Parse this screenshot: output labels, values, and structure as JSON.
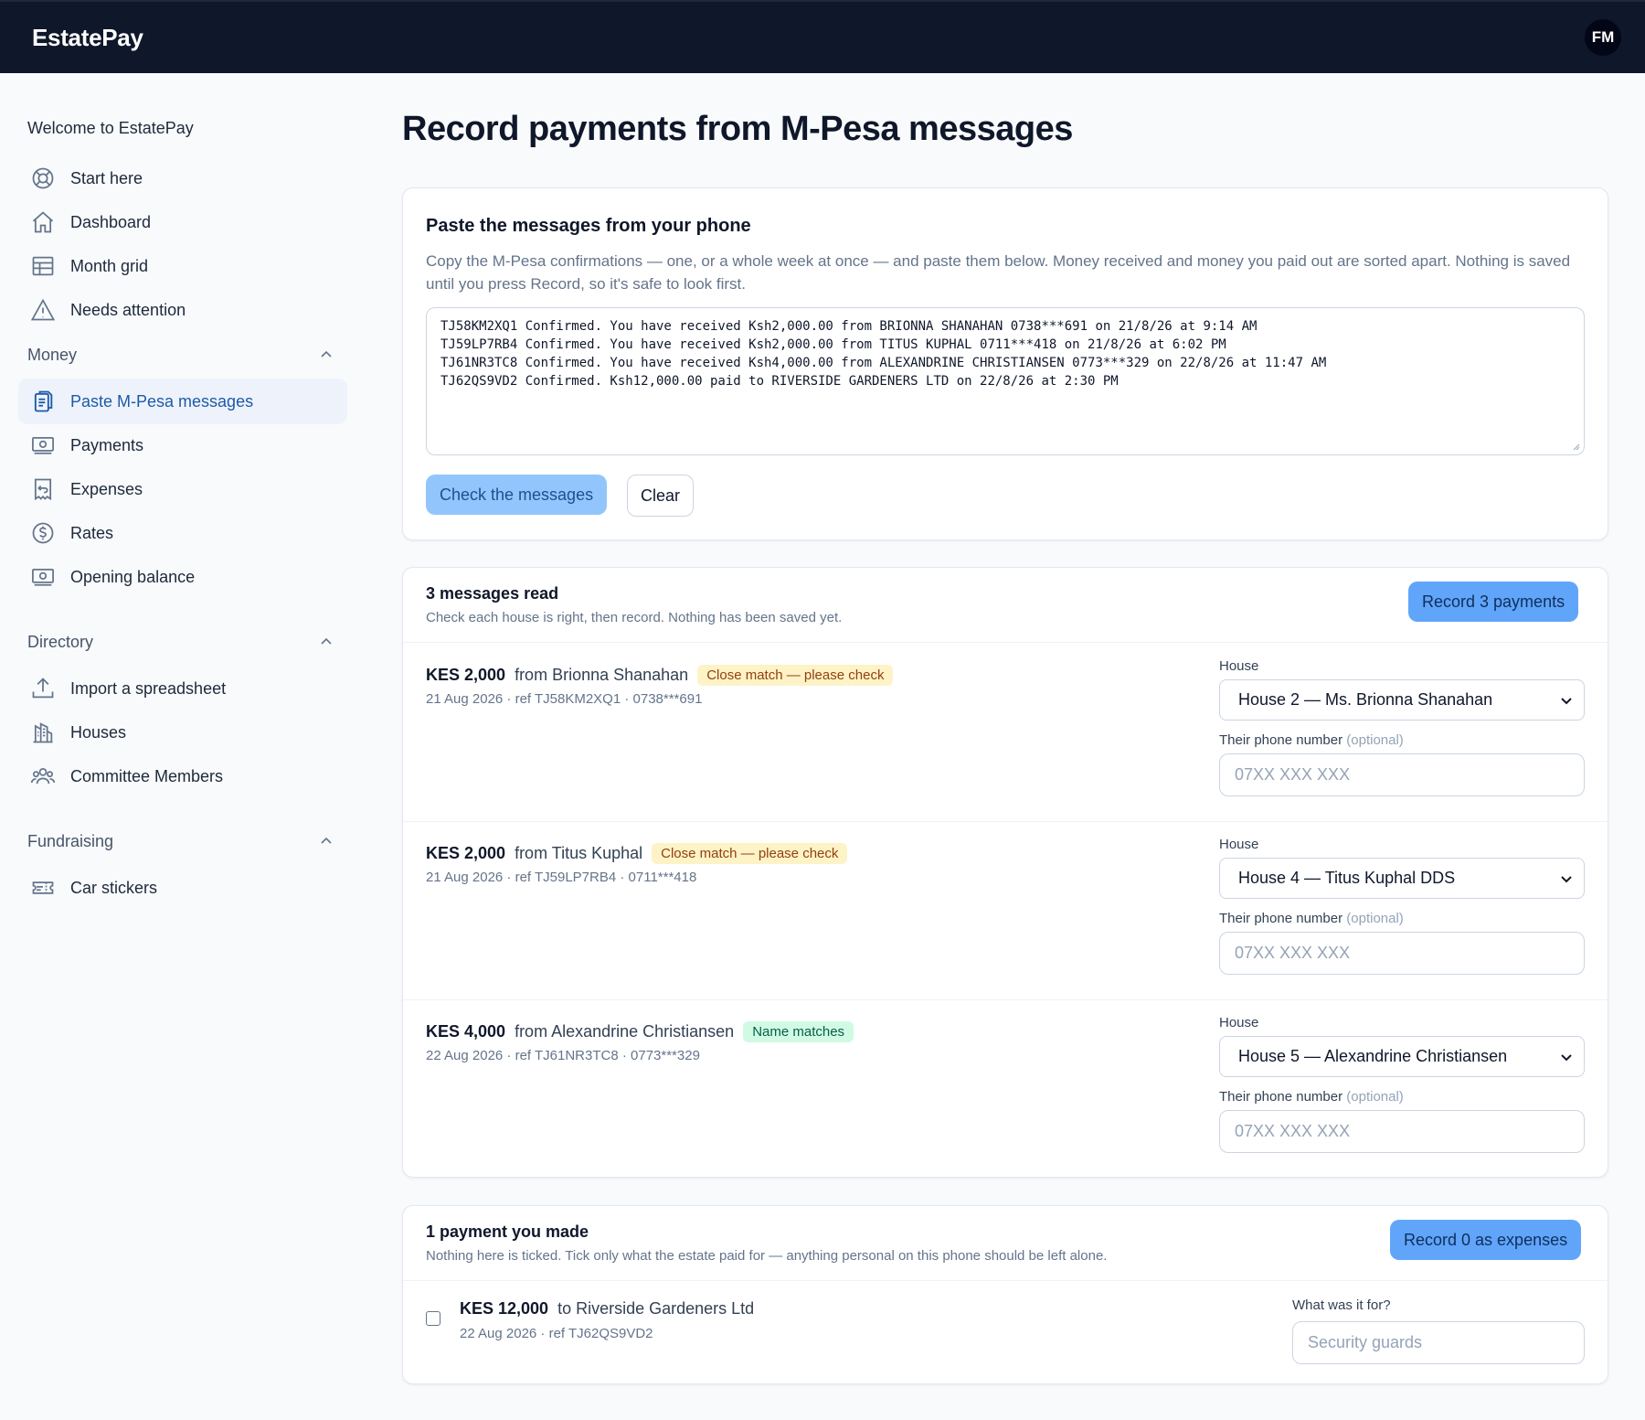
{
  "app": {
    "brand": "EstatePay",
    "user_initials": "FM"
  },
  "sidebar": {
    "welcome": "Welcome to EstatePay",
    "top_items": [
      {
        "label": "Start here",
        "icon": "lifebuoy-icon"
      },
      {
        "label": "Dashboard",
        "icon": "home-icon"
      },
      {
        "label": "Month grid",
        "icon": "table-icon"
      },
      {
        "label": "Needs attention",
        "icon": "warning-icon"
      }
    ],
    "sections": [
      {
        "title": "Money",
        "items": [
          {
            "label": "Paste M-Pesa messages",
            "icon": "clipboard-icon",
            "active": true
          },
          {
            "label": "Payments",
            "icon": "banknote-icon"
          },
          {
            "label": "Expenses",
            "icon": "receipt-refund-icon"
          },
          {
            "label": "Rates",
            "icon": "dollar-circle-icon"
          },
          {
            "label": "Opening balance",
            "icon": "banknote-icon"
          }
        ]
      },
      {
        "title": "Directory",
        "items": [
          {
            "label": "Import a spreadsheet",
            "icon": "upload-icon"
          },
          {
            "label": "Houses",
            "icon": "buildings-icon"
          },
          {
            "label": "Committee Members",
            "icon": "users-icon"
          }
        ]
      },
      {
        "title": "Fundraising",
        "items": [
          {
            "label": "Car stickers",
            "icon": "ticket-icon"
          }
        ]
      }
    ]
  },
  "main": {
    "title": "Record payments from M-Pesa messages",
    "paste_card": {
      "title": "Paste the messages from your phone",
      "description": "Copy the M-Pesa confirmations — one, or a whole week at once — and paste them below. Money received and money you paid out are sorted apart. Nothing is saved until you press Record, so it's safe to look first.",
      "messages": [
        "TJ58KM2XQ1 Confirmed. You have received Ksh2,000.00 from BRIONNA SHANAHAN 0738***691 on 21/8/26 at 9:14 AM",
        "TJ59LP7RB4 Confirmed. You have received Ksh2,000.00 from TITUS KUPHAL 0711***418 on 21/8/26 at 6:02 PM",
        "TJ61NR3TC8 Confirmed. You have received Ksh4,000.00 from ALEXANDRINE CHRISTIANSEN 0773***329 on 22/8/26 at 11:47 AM",
        "TJ62QS9VD2 Confirmed. Ksh12,000.00 paid to RIVERSIDE GARDENERS LTD on 22/8/26 at 2:30 PM"
      ],
      "check_label": "Check the messages",
      "clear_label": "Clear"
    },
    "received_card": {
      "title": "3 messages read",
      "subtitle": "Check each house is right, then record. Nothing has been saved yet.",
      "record_label": "Record 3 payments",
      "house_label": "House",
      "phone_label": "Their phone number",
      "phone_optional": "(optional)",
      "phone_placeholder": "07XX XXX XXX",
      "rows": [
        {
          "amount": "KES 2,000",
          "from": "from Brionna Shanahan",
          "badge": "Close match — please check",
          "badge_type": "warn",
          "meta": "21 Aug 2026 · ref TJ58KM2XQ1 · 0738***691",
          "house": "House 2 — Ms. Brionna Shanahan"
        },
        {
          "amount": "KES 2,000",
          "from": "from Titus Kuphal",
          "badge": "Close match — please check",
          "badge_type": "warn",
          "meta": "21 Aug 2026 · ref TJ59LP7RB4 · 0711***418",
          "house": "House 4 — Titus Kuphal DDS"
        },
        {
          "amount": "KES 4,000",
          "from": "from Alexandrine Christiansen",
          "badge": "Name matches",
          "badge_type": "ok",
          "meta": "22 Aug 2026 · ref TJ61NR3TC8 · 0773***329",
          "house": "House 5 — Alexandrine Christiansen"
        }
      ]
    },
    "paid_card": {
      "title": "1 payment you made",
      "subtitle": "Nothing here is ticked. Tick only what the estate paid for — anything personal on this phone should be left alone.",
      "record_label": "Record 0 as expenses",
      "amount": "KES 12,000",
      "to": "to Riverside Gardeners Ltd",
      "meta": "22 Aug 2026 · ref TJ62QS9VD2",
      "for_label": "What was it for?",
      "for_placeholder": "Security guards"
    }
  },
  "colors": {
    "topbar": "#0f172a",
    "accent": "#1d5aa8",
    "primary_button": "#60a5fa",
    "warn_badge_bg": "#fef3c7",
    "ok_badge_bg": "#d1fae5"
  }
}
